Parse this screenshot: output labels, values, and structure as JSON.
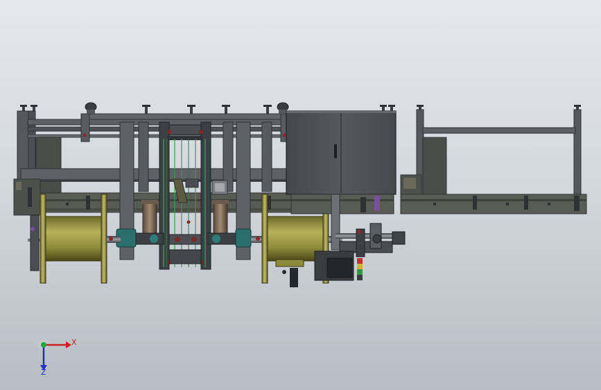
{
  "viewport": {
    "background_top": "#e5e8ec",
    "background_bottom": "#b7bdc4"
  },
  "colors": {
    "frame": "#4f5357",
    "frame_dark": "#3a3d40",
    "frame_light": "#6a6e72",
    "rail": "#5a5e55",
    "cabinet": "#4b4e53",
    "spool": "#8e8a3c",
    "spool_light": "#b8b25a",
    "spool_dark": "#55521e",
    "accent_teal": "#2f7b7b",
    "accent_green": "#3a9b50",
    "accent_purple": "#7a4fa0",
    "signal_red": "#c33030",
    "signal_yellow": "#d6b22a",
    "signal_green": "#2f9b3f"
  },
  "triad": {
    "x_label": "X",
    "z_label": "Z",
    "x_color": "#cc1f1f",
    "y_color": "#1fa83a",
    "z_color": "#1f2fcc"
  }
}
